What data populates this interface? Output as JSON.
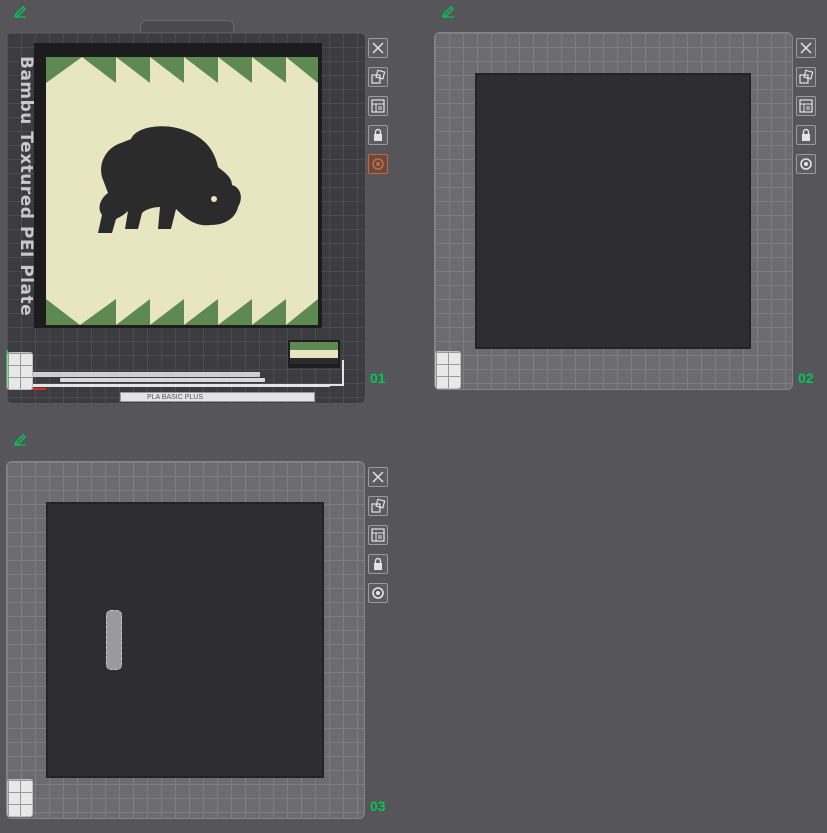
{
  "plates": [
    {
      "number": "01",
      "bed_label": "Bambu Textured PEI Plate",
      "bar_text": "PLA BASIC PLUS",
      "selected": true
    },
    {
      "number": "02"
    },
    {
      "number": "03"
    }
  ],
  "tool_icons": [
    "close-icon",
    "arrange-icon",
    "layers-icon",
    "lock-icon",
    "settings-icon"
  ],
  "colors": {
    "plate_number": "#00c853",
    "print_bg": "#e8e6c0",
    "print_accent": "#5e8a52",
    "active_tool": "#c0684a"
  }
}
